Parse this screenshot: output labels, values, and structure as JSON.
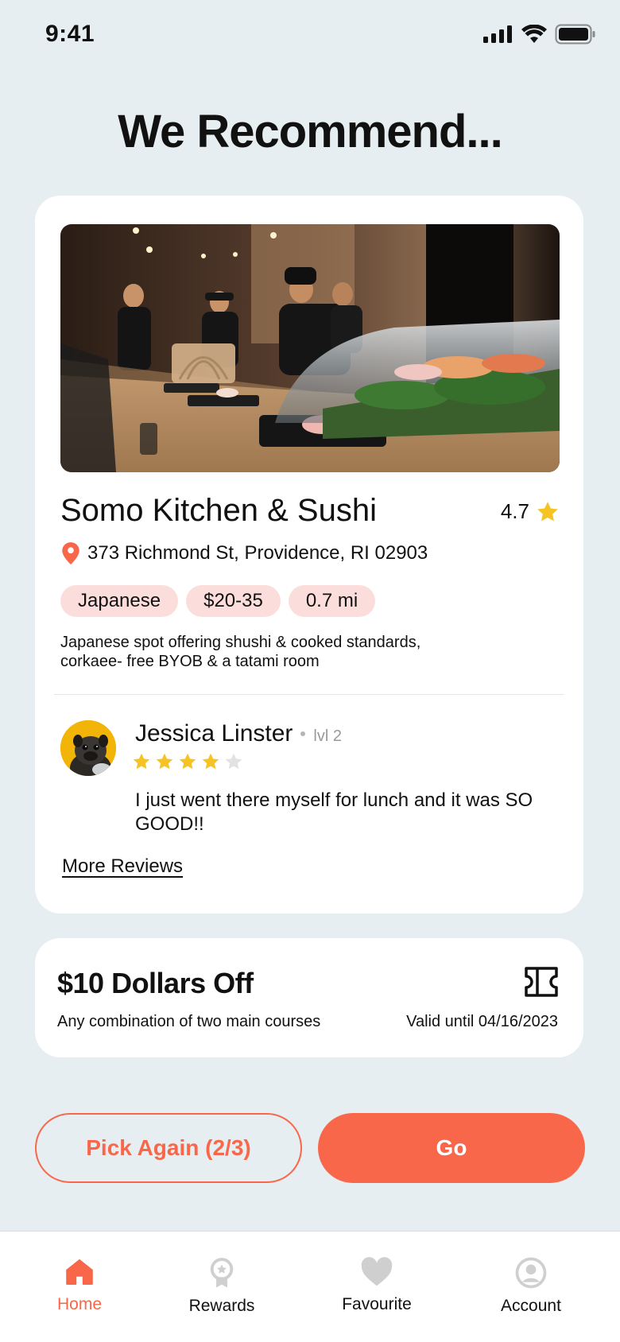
{
  "status_bar": {
    "time": "9:41"
  },
  "page": {
    "title": "We Recommend..."
  },
  "restaurant": {
    "name": "Somo Kitchen & Sushi",
    "rating": "4.7",
    "address": "373 Richmond St, Providence, RI 02903",
    "tags": [
      "Japanese",
      "$20-35",
      "0.7 mi"
    ],
    "description": "Japanese spot offering shushi & cooked standards, corkaee- free BYOB & a tatami room"
  },
  "review": {
    "author": "Jessica Linster",
    "level": "lvl 2",
    "stars": 4,
    "stars_max": 5,
    "text": "I just went there myself for lunch and it was SO GOOD!!",
    "more_label": "More Reviews"
  },
  "coupon": {
    "title": "$10 Dollars Off",
    "subtitle": "Any combination of two main courses",
    "valid": "Valid until 04/16/2023",
    "icon": "ticket-icon"
  },
  "actions": {
    "pick_again": "Pick Again (2/3)",
    "go": "Go"
  },
  "tabs": [
    {
      "label": "Home",
      "icon": "home-icon",
      "active": true
    },
    {
      "label": "Rewards",
      "icon": "award-icon",
      "active": false
    },
    {
      "label": "Favourite",
      "icon": "heart-icon",
      "active": false
    },
    {
      "label": "Account",
      "icon": "user-icon",
      "active": false
    }
  ],
  "colors": {
    "accent": "#f86749",
    "star": "#f5c324",
    "tag_bg": "#fbdedb",
    "background": "#e7eef1"
  }
}
